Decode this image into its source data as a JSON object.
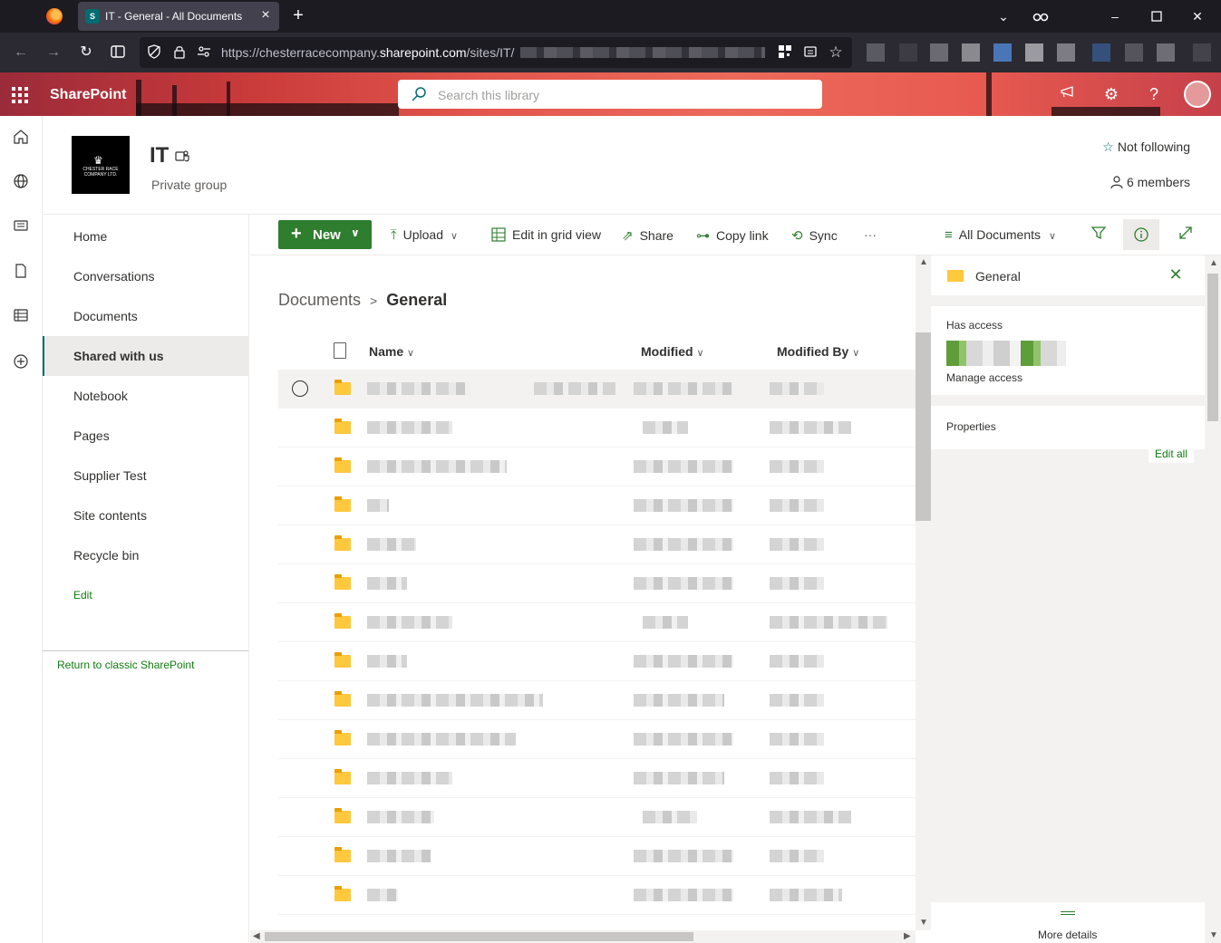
{
  "browser": {
    "tab_title": "IT - General - All Documents",
    "url_host_prefix": "https://chesterracecompany.",
    "url_host": "sharepoint.com",
    "url_path": "/sites/IT/",
    "tab_close_glyph": "×",
    "new_tab_glyph": "+"
  },
  "suite": {
    "app_name": "SharePoint",
    "search_placeholder": "Search this library"
  },
  "site": {
    "name": "IT",
    "subtitle": "Private group",
    "follow_label": "Not following",
    "members_label": "6 members",
    "logo_text": "CHESTER RACE COMPANY LTD."
  },
  "nav": {
    "items": [
      {
        "label": "Home"
      },
      {
        "label": "Conversations"
      },
      {
        "label": "Documents"
      },
      {
        "label": "Shared with us"
      },
      {
        "label": "Notebook"
      },
      {
        "label": "Pages"
      },
      {
        "label": "Supplier Test"
      },
      {
        "label": "Site contents"
      },
      {
        "label": "Recycle bin"
      }
    ],
    "active_index": 3,
    "edit_label": "Edit",
    "classic_label": "Return to classic SharePoint"
  },
  "commands": {
    "new_label": "New",
    "upload_label": "Upload",
    "grid_label": "Edit in grid view",
    "share_label": "Share",
    "copy_link_label": "Copy link",
    "sync_label": "Sync",
    "more_label": "···",
    "view_label": "All Documents"
  },
  "list": {
    "breadcrumb_root": "Documents",
    "breadcrumb_current": "General",
    "columns": {
      "name": "Name",
      "modified": "Modified",
      "modified_by": "Modified By"
    },
    "row_count_visible": 14
  },
  "details": {
    "title": "General",
    "has_access_label": "Has access",
    "manage_access_label": "Manage access",
    "properties_label": "Properties",
    "edit_all_label": "Edit all",
    "more_details_label": "More details"
  },
  "colors": {
    "accent_green": "#2f7d2f",
    "folder_yellow": "#ffc83d",
    "browser_dark": "#1c1b22"
  }
}
